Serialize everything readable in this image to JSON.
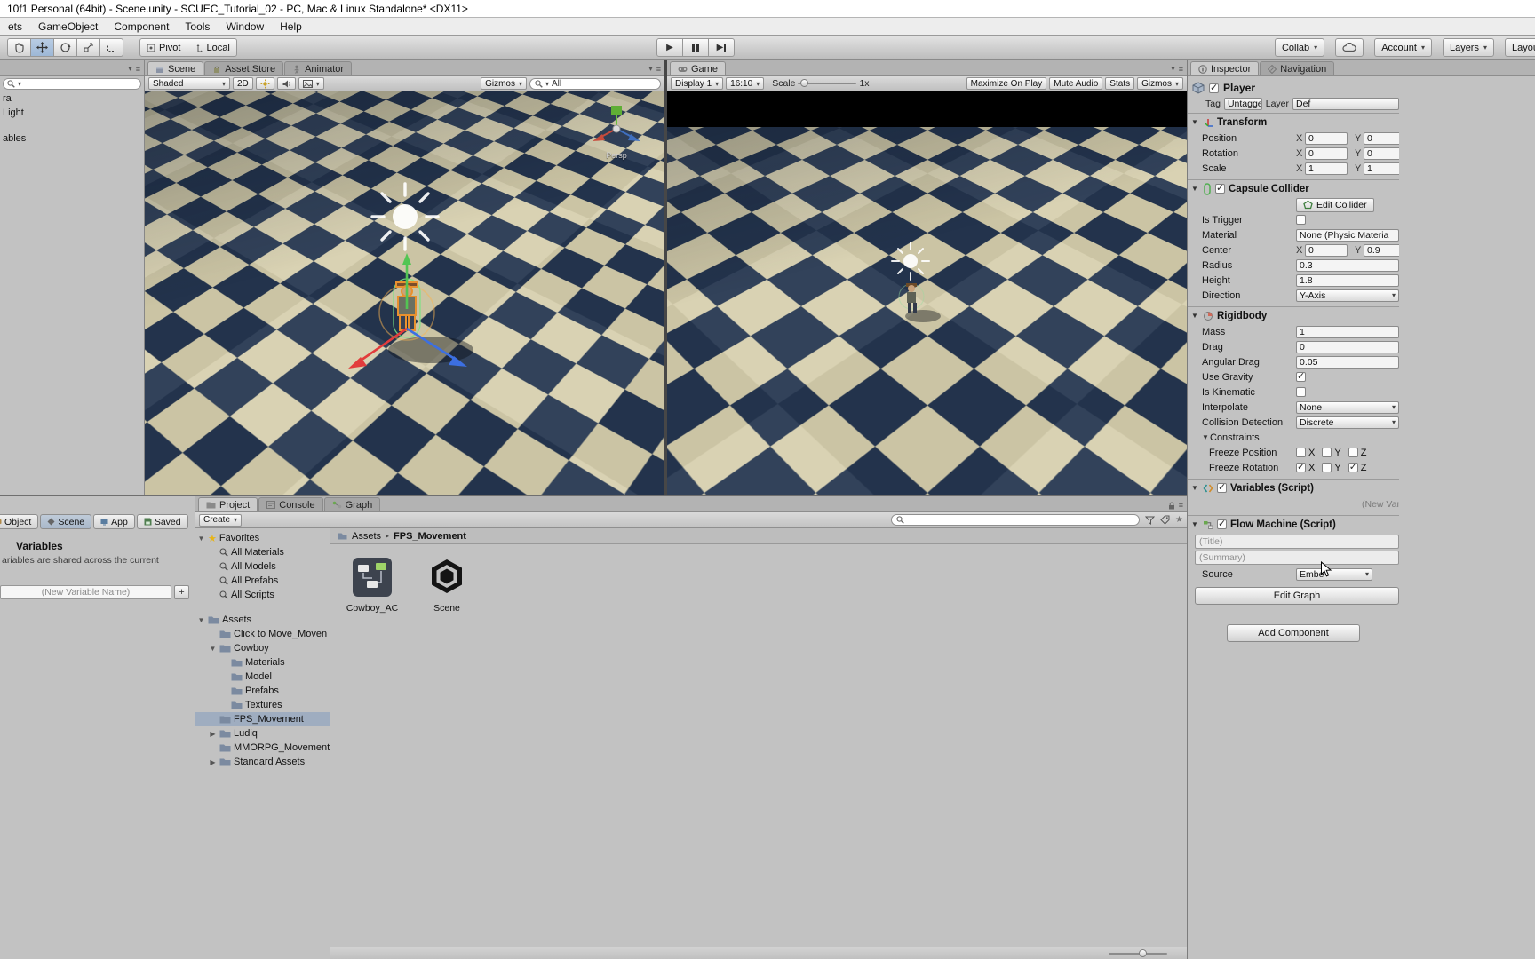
{
  "window": {
    "title": "10f1 Personal (64bit) - Scene.unity - SCUEC_Tutorial_02 - PC, Mac & Linux Standalone* <DX11>"
  },
  "menu": {
    "items": [
      "ets",
      "GameObject",
      "Component",
      "Tools",
      "Window",
      "Help"
    ]
  },
  "toolbar": {
    "pivot": "Pivot",
    "local": "Local",
    "collab": "Collab",
    "account": "Account",
    "layers": "Layers",
    "layout": "Layout"
  },
  "hierarchy": {
    "items": [
      "ra",
      "Light",
      "ables"
    ]
  },
  "scene_panel": {
    "tabs": [
      "Scene",
      "Asset Store",
      "Animator"
    ],
    "shaded": "Shaded",
    "mode2d": "2D",
    "gizmos": "Gizmos",
    "search_value": "All",
    "persp": "Persp"
  },
  "game_panel": {
    "tab": "Game",
    "display": "Display 1",
    "aspect": "16:10",
    "scale_label": "Scale",
    "scale_value": "1x",
    "maximize": "Maximize On Play",
    "mute": "Mute Audio",
    "stats": "Stats",
    "gizmos": "Gizmos"
  },
  "variables_panel": {
    "tabs": [
      {
        "label": "Object",
        "active": false
      },
      {
        "label": "Scene",
        "active": true
      },
      {
        "label": "App",
        "active": false
      },
      {
        "label": "Saved",
        "active": false
      }
    ],
    "title": "Variables",
    "description": "ariables are shared across the current",
    "placeholder": "(New Variable Name)",
    "add_label": "+"
  },
  "project": {
    "tabs": [
      "Project",
      "Console",
      "Graph"
    ],
    "create": "Create",
    "breadcrumb": {
      "root": "Assets",
      "current": "FPS_Movement"
    },
    "tree": [
      {
        "label": "Favorites",
        "depth": 0,
        "icon": "star",
        "arrow": "open"
      },
      {
        "label": "All Materials",
        "depth": 1,
        "icon": "lens"
      },
      {
        "label": "All Models",
        "depth": 1,
        "icon": "lens"
      },
      {
        "label": "All Prefabs",
        "depth": 1,
        "icon": "lens"
      },
      {
        "label": "All Scripts",
        "depth": 1,
        "icon": "lens"
      },
      {
        "label": "Assets",
        "depth": 0,
        "icon": "folder",
        "arrow": "open",
        "gap": true
      },
      {
        "label": "Click to Move_Moven",
        "depth": 1,
        "icon": "folder"
      },
      {
        "label": "Cowboy",
        "depth": 1,
        "icon": "folder",
        "arrow": "open"
      },
      {
        "label": "Materials",
        "depth": 2,
        "icon": "folder"
      },
      {
        "label": "Model",
        "depth": 2,
        "icon": "folder"
      },
      {
        "label": "Prefabs",
        "depth": 2,
        "icon": "folder"
      },
      {
        "label": "Textures",
        "depth": 2,
        "icon": "folder"
      },
      {
        "label": "FPS_Movement",
        "depth": 1,
        "icon": "folder",
        "selected": true
      },
      {
        "label": "Ludiq",
        "depth": 1,
        "icon": "folder",
        "arrow": "closed"
      },
      {
        "label": "MMORPG_Movement",
        "depth": 1,
        "icon": "folder"
      },
      {
        "label": "Standard Assets",
        "depth": 1,
        "icon": "folder",
        "arrow": "closed"
      }
    ],
    "assets": [
      {
        "name": "Cowboy_AC",
        "kind": "graph"
      },
      {
        "name": "Scene",
        "kind": "scene"
      }
    ]
  },
  "inspector": {
    "tabs": [
      "Inspector",
      "Navigation"
    ],
    "name": "Player",
    "enabled": true,
    "tag_label": "Tag",
    "tag": "Untagged",
    "layer_label": "Layer",
    "layer": "Def",
    "add_component": "Add Component",
    "components": [
      {
        "title": "Transform",
        "icon": "transform",
        "rows": [
          {
            "type": "vec",
            "label": "Position",
            "axes": [
              {
                "axis": "X",
                "value": "0"
              },
              {
                "axis": "Y",
                "value": "0"
              }
            ]
          },
          {
            "type": "vec",
            "label": "Rotation",
            "axes": [
              {
                "axis": "X",
                "value": "0"
              },
              {
                "axis": "Y",
                "value": "0"
              }
            ]
          },
          {
            "type": "vec",
            "label": "Scale",
            "axes": [
              {
                "axis": "X",
                "value": "1"
              },
              {
                "axis": "Y",
                "value": "1"
              }
            ]
          }
        ]
      },
      {
        "title": "Capsule Collider",
        "icon": "capsule",
        "checkbox": true,
        "rows": [
          {
            "type": "button-row",
            "button": "Edit Collider"
          },
          {
            "type": "check",
            "label": "Is Trigger",
            "checked": false
          },
          {
            "type": "field",
            "label": "Material",
            "value": "None (Physic Materia"
          },
          {
            "type": "vec",
            "label": "Center",
            "axes": [
              {
                "axis": "X",
                "value": "0"
              },
              {
                "axis": "Y",
                "value": "0.9"
              }
            ]
          },
          {
            "type": "field",
            "label": "Radius",
            "value": "0.3"
          },
          {
            "type": "field",
            "label": "Height",
            "value": "1.8"
          },
          {
            "type": "dropdown",
            "label": "Direction",
            "value": "Y-Axis"
          }
        ]
      },
      {
        "title": "Rigidbody",
        "icon": "rigidbody",
        "rows": [
          {
            "type": "field",
            "label": "Mass",
            "value": "1"
          },
          {
            "type": "field",
            "label": "Drag",
            "value": "0"
          },
          {
            "type": "field",
            "label": "Angular Drag",
            "value": "0.05"
          },
          {
            "type": "check",
            "label": "Use Gravity",
            "checked": true
          },
          {
            "type": "check",
            "label": "Is Kinematic",
            "checked": false
          },
          {
            "type": "dropdown",
            "label": "Interpolate",
            "value": "None"
          },
          {
            "type": "dropdown",
            "label": "Collision Detection",
            "value": "Discrete"
          },
          {
            "type": "foldout",
            "label": "Constraints"
          },
          {
            "type": "axes-check",
            "label": "Freeze Position",
            "axes": [
              {
                "axis": "X",
                "checked": false
              },
              {
                "axis": "Y",
                "checked": false
              },
              {
                "axis": "Z",
                "checked": false
              }
            ]
          },
          {
            "type": "axes-check",
            "label": "Freeze Rotation",
            "axes": [
              {
                "axis": "X",
                "checked": true
              },
              {
                "axis": "Y",
                "checked": false
              },
              {
                "axis": "Z",
                "checked": true
              }
            ]
          }
        ]
      },
      {
        "title": "Variables (Script)",
        "icon": "variables",
        "checkbox": true,
        "rows": [
          {
            "type": "right-text",
            "value": "(New Vari"
          }
        ]
      },
      {
        "title": "Flow Machine (Script)",
        "icon": "flow",
        "checkbox": true,
        "rows": [
          {
            "type": "wide-field",
            "value": "(Title)"
          },
          {
            "type": "wide-field",
            "value": "(Summary)"
          },
          {
            "type": "dropdown-small",
            "label": "Source",
            "value": "Embe"
          },
          {
            "type": "big-button",
            "value": "Edit Graph"
          }
        ]
      }
    ]
  }
}
